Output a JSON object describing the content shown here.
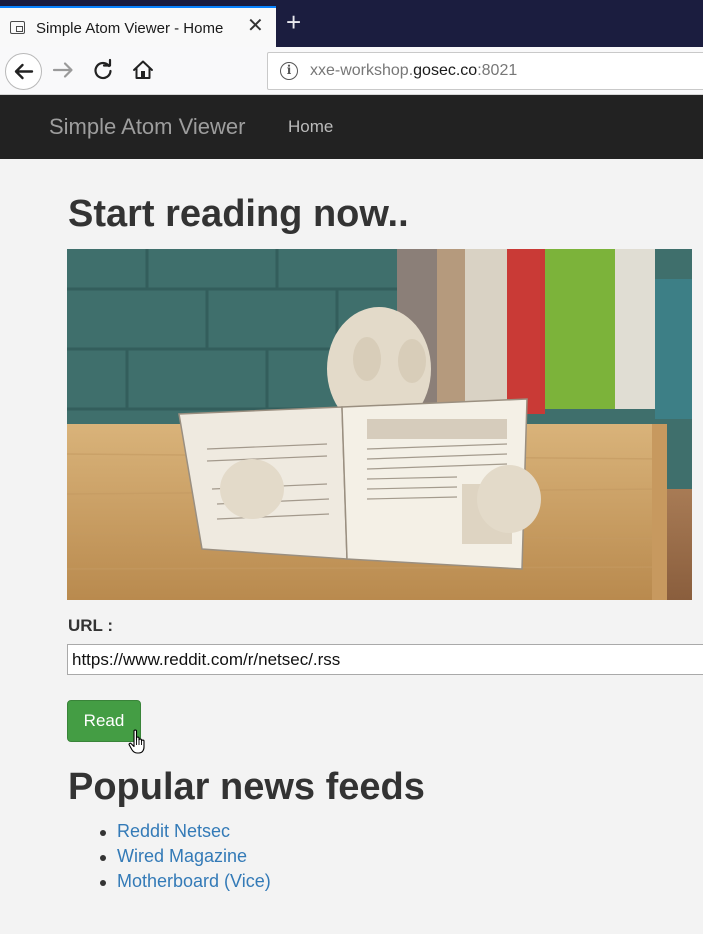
{
  "browser": {
    "tab_title": "Simple Atom Viewer - Home",
    "tab_close": "✕",
    "new_tab": "+",
    "url_prefix": "xxe-workshop.",
    "url_host": "gosec.co",
    "url_suffix": ":8021",
    "info_icon": "i"
  },
  "site": {
    "brand": "Simple Atom Viewer",
    "nav_home": "Home"
  },
  "main": {
    "heading": "Start reading now..",
    "url_label": "URL :",
    "url_value": "https://www.reddit.com/r/netsec/.rss",
    "read_button": "Read",
    "feeds_heading": "Popular news feeds",
    "feeds": [
      {
        "label": "Reddit Netsec"
      },
      {
        "label": "Wired Magazine"
      },
      {
        "label": "Motherboard (Vice)"
      }
    ]
  },
  "colors": {
    "navbar_bg": "#222222",
    "button_green": "#449d44",
    "link_blue": "#337ab7",
    "tabstrip": "#1b1d3f"
  }
}
